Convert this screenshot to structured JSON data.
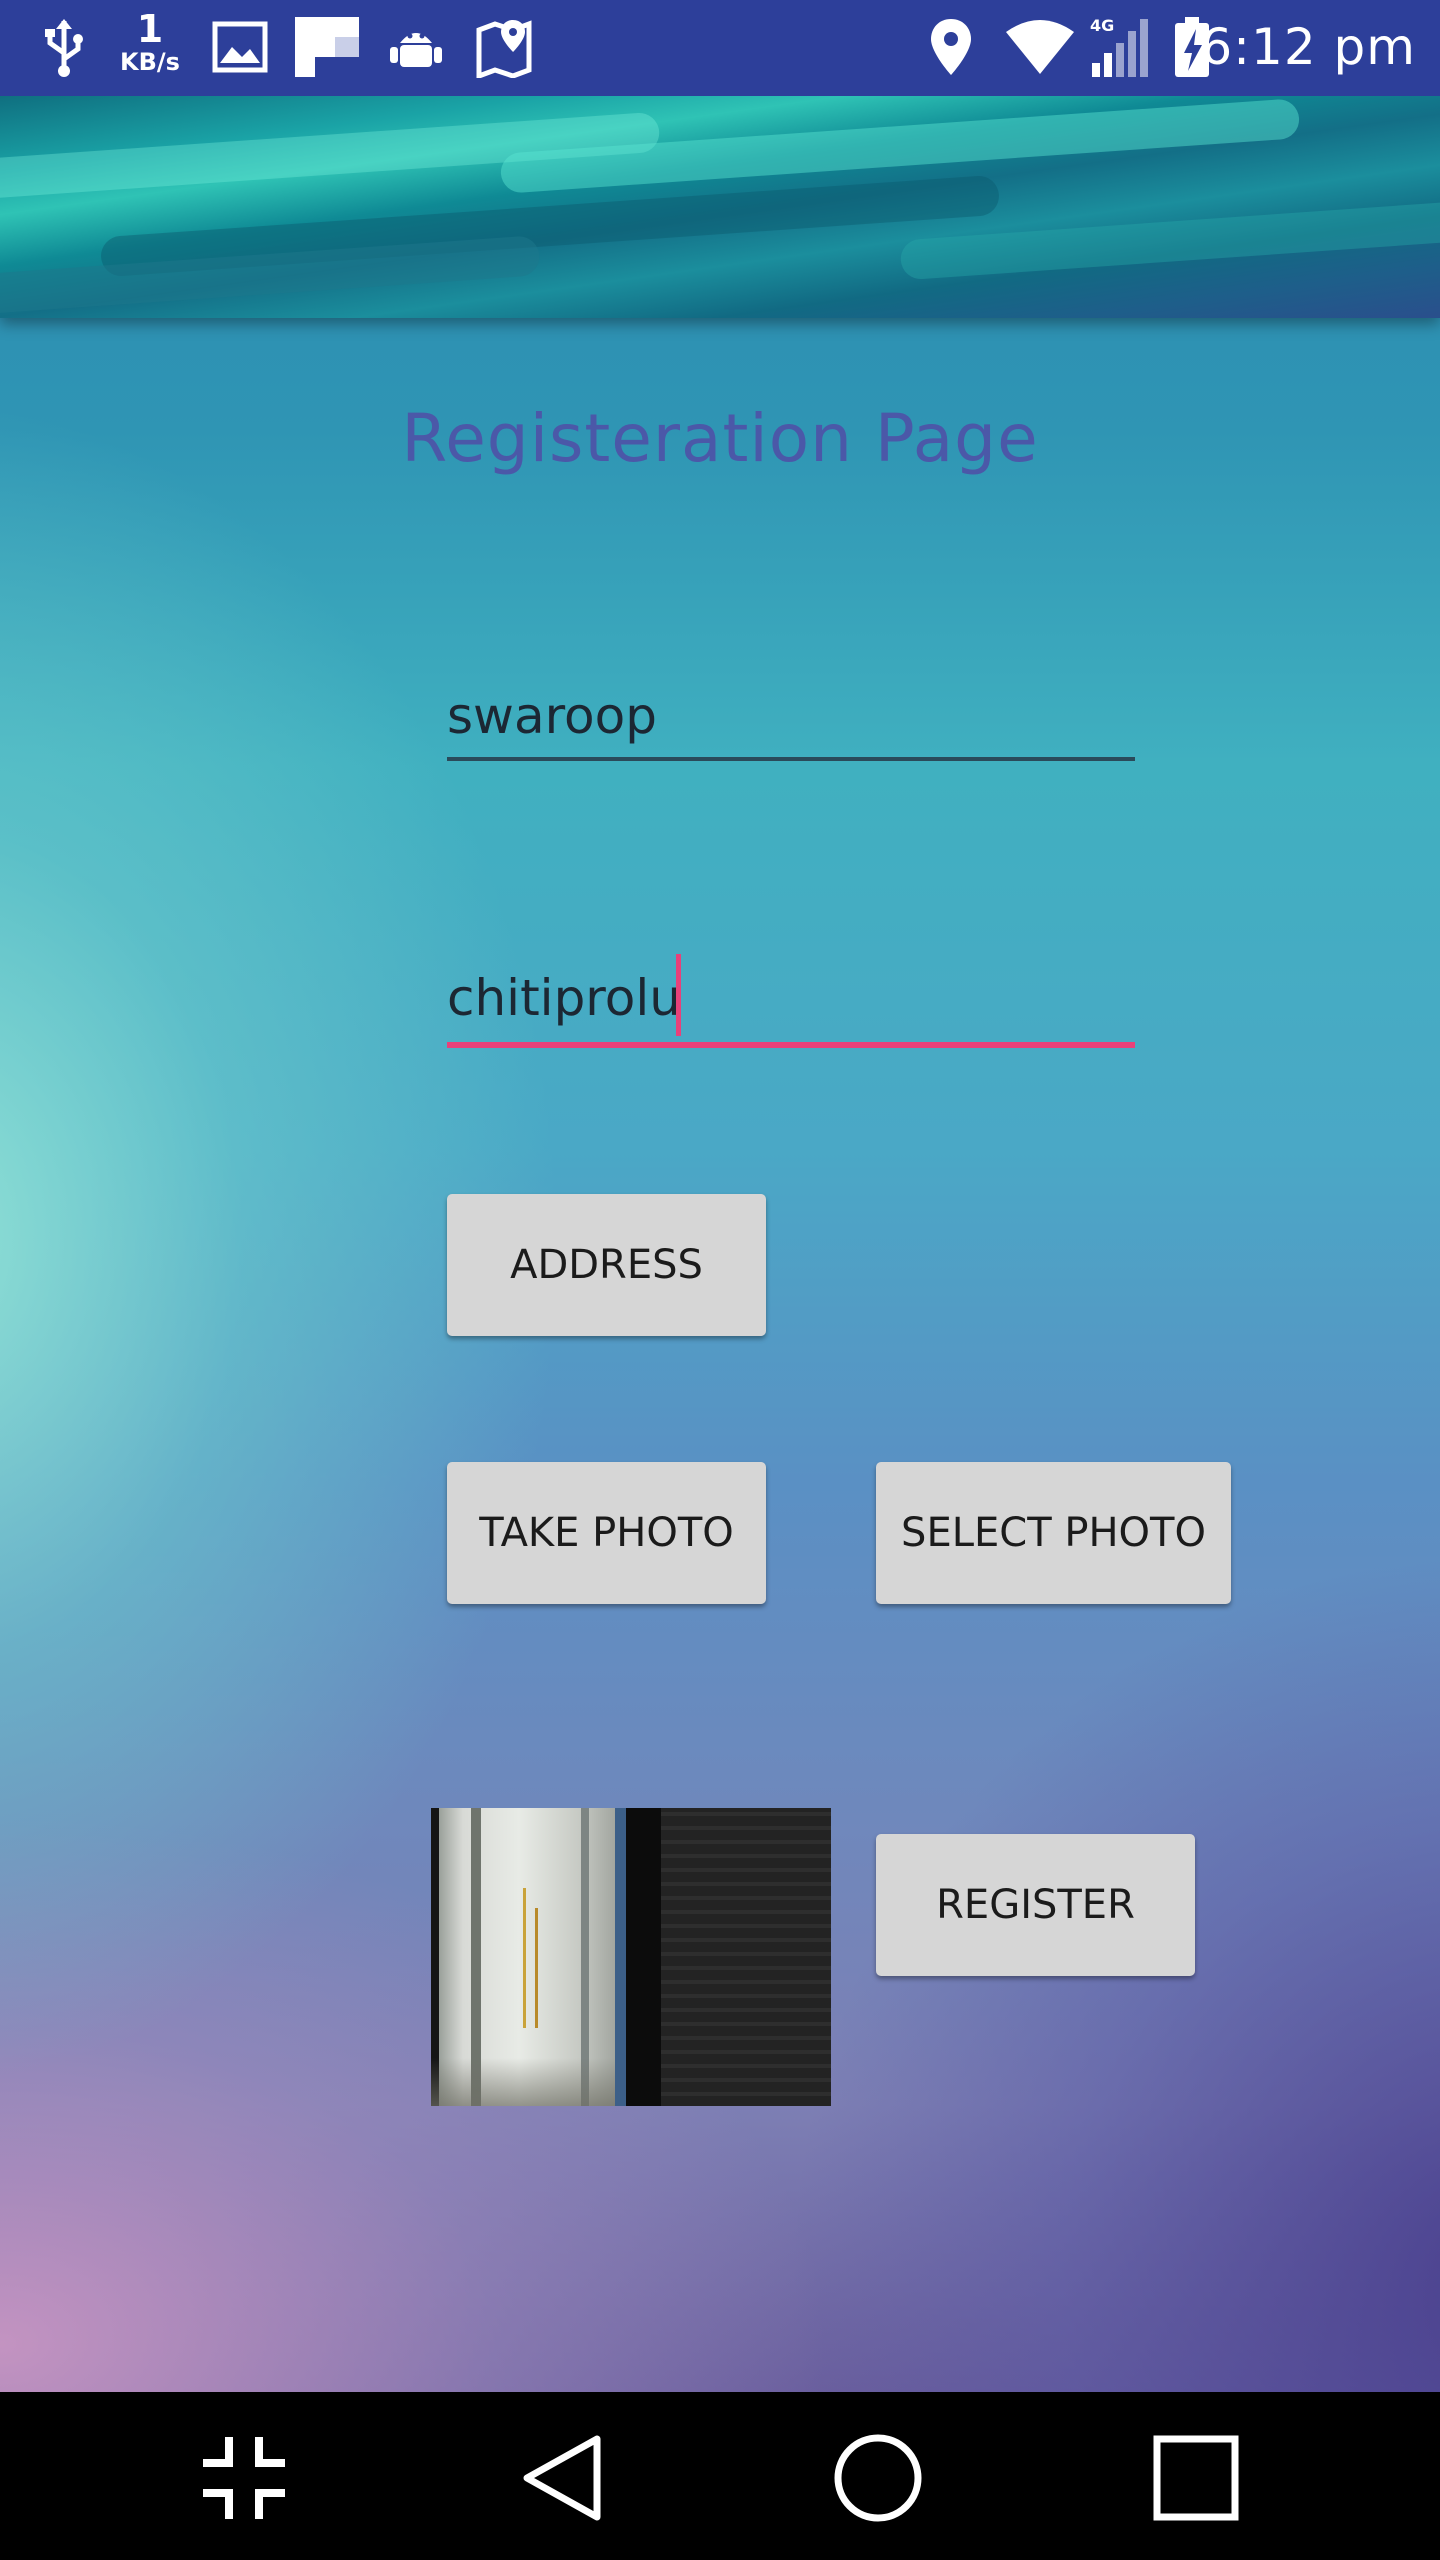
{
  "status_bar": {
    "network_speed_value": "1",
    "network_speed_unit": "KB/s",
    "network_type": "4G",
    "time": "6:12 pm",
    "icons": [
      "usb-icon",
      "gallery-icon",
      "flipboard-icon",
      "android-debug-icon",
      "maps-icon",
      "location-icon",
      "wifi-icon",
      "signal-icon",
      "battery-charging-icon"
    ]
  },
  "page": {
    "title": "Registeration Page"
  },
  "form": {
    "first_name_value": "swaroop",
    "last_name_value": "chitiprolu",
    "address_label": "ADDRESS",
    "take_photo_label": "TAKE PHOTO",
    "select_photo_label": "SELECT PHOTO",
    "register_label": "REGISTER"
  },
  "colors": {
    "status_bar": "#2d3f9a",
    "title": "#4b58a8",
    "focused_underline": "#e8417a",
    "button_bg": "#d6d6d6"
  },
  "nav_bar": {
    "icons": [
      "collapse-icon",
      "back-icon",
      "home-icon",
      "recents-icon"
    ]
  }
}
